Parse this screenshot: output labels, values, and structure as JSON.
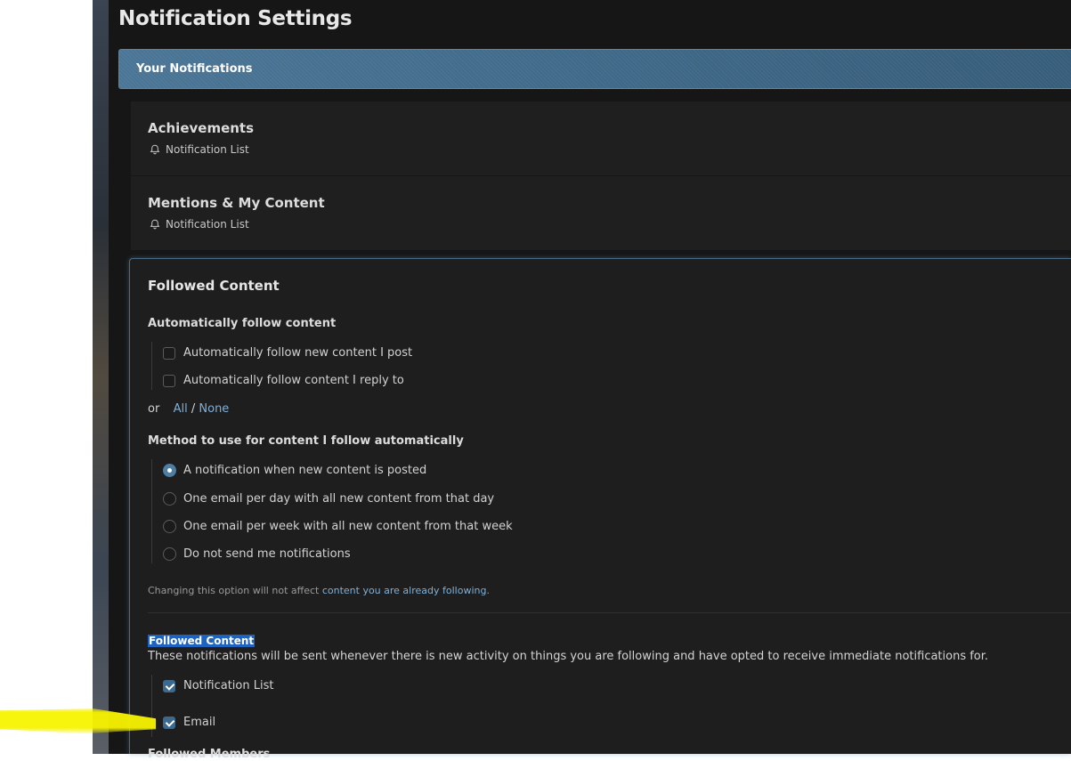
{
  "page": {
    "title": "Notification Settings"
  },
  "block_header": {
    "title": "Your Notifications"
  },
  "rows": [
    {
      "title": "Achievements",
      "sub_icon": "bell-icon",
      "sub_label": "Notification List"
    },
    {
      "title": "Mentions & My Content",
      "sub_icon": "bell-icon",
      "sub_label": "Notification List"
    }
  ],
  "followed": {
    "title": "Followed Content",
    "auto_follow": {
      "label": "Automatically follow content",
      "options": [
        {
          "label": "Automatically follow new content I post",
          "checked": false
        },
        {
          "label": "Automatically follow content I reply to",
          "checked": false
        }
      ],
      "or_text": "or",
      "all_label": "All",
      "separator": "/",
      "none_label": "None"
    },
    "method": {
      "label": "Method to use for content I follow automatically",
      "options": [
        {
          "label": "A notification when new content is posted",
          "selected": true
        },
        {
          "label": "One email per day with all new content from that day",
          "selected": false
        },
        {
          "label": "One email per week with all new content from that week",
          "selected": false
        },
        {
          "label": "Do not send me notifications",
          "selected": false
        }
      ],
      "note_prefix": "Changing this option will not affect",
      "note_link": "content you are already following",
      "note_suffix": "."
    },
    "immediate": {
      "title": "Followed Content",
      "description": "These notifications will be sent whenever there is new activity on things you are following and have opted to receive immediate notifications for.",
      "options": [
        {
          "label": "Notification List",
          "checked": true
        },
        {
          "label": "Email",
          "checked": true
        }
      ]
    },
    "next_partial_label": "Followed Members"
  },
  "colors": {
    "panel_bg": "#161616",
    "accent": "#4b7596",
    "link": "#7fb0d8",
    "highlight": "#f7f300"
  }
}
